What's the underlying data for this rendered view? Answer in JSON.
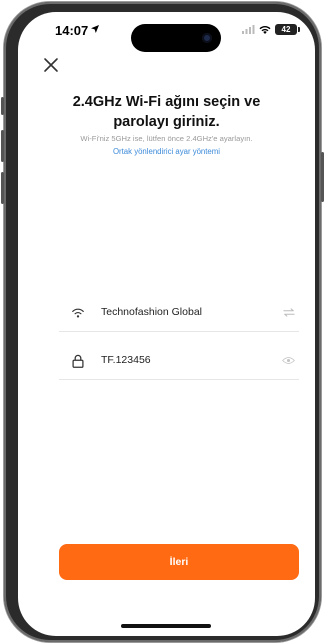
{
  "status_bar": {
    "time": "14:07",
    "battery": "42"
  },
  "header": {
    "title_line1": "2.4GHz Wi-Fi ağını seçin ve",
    "title_line2": "parolayı giriniz.",
    "subtitle": "Wi-Fi'niz 5GHz ise, lütfen önce 2.4GHz'e ayarlayın.",
    "guide_link": "Ortak yönlendirici ayar yöntemi"
  },
  "form": {
    "wifi_name": "Technofashion Global",
    "password": "TF.123456"
  },
  "footer": {
    "next_label": "İleri"
  },
  "colors": {
    "accent": "#ff6a13",
    "link": "#3d8bd9"
  },
  "icons": {
    "close": "close-icon",
    "wifi": "wifi-icon",
    "lock": "lock-icon",
    "swap": "swap-icon",
    "eye": "eye-icon"
  }
}
